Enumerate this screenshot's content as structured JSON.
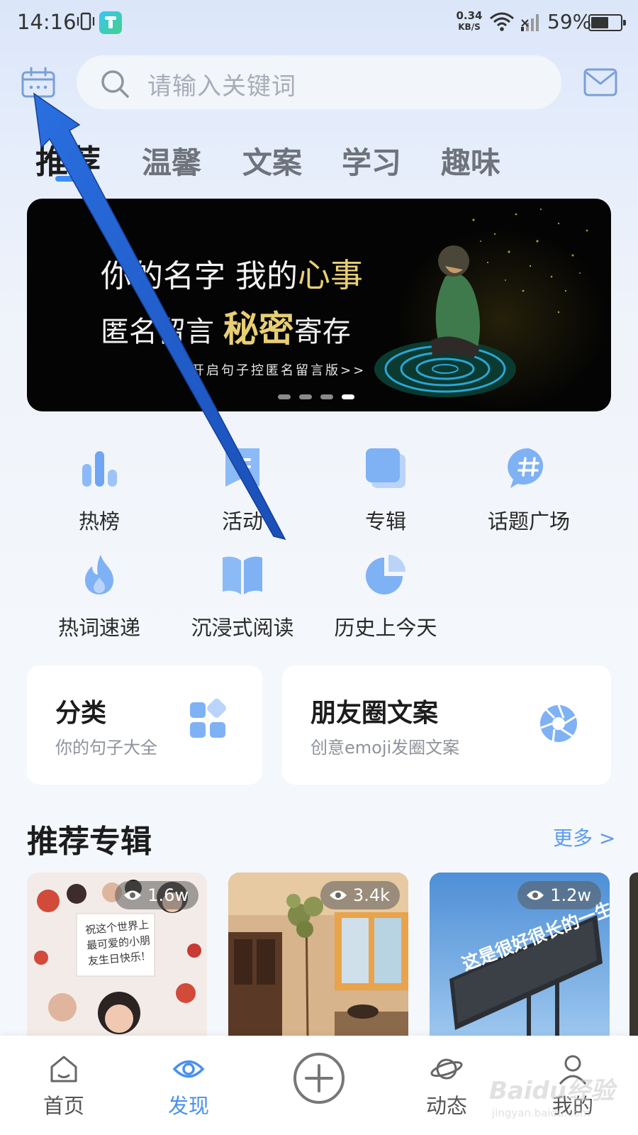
{
  "status_bar": {
    "time": "14:16",
    "net_speed_value": "0.34",
    "net_speed_unit": "KB/S",
    "battery": "59%",
    "battery_level": 0.59,
    "icons": [
      "vibrate-icon",
      "app-notification-icon",
      "wifi-icon",
      "cellular-signal-icon",
      "battery-icon"
    ]
  },
  "header": {
    "search_placeholder": "请输入关键词",
    "left_icon": "calendar-icon",
    "right_icon": "mail-icon"
  },
  "tabs": [
    {
      "label": "推荐",
      "active": true
    },
    {
      "label": "温馨",
      "active": false
    },
    {
      "label": "文案",
      "active": false
    },
    {
      "label": "学习",
      "active": false
    },
    {
      "label": "趣味",
      "active": false
    }
  ],
  "banner": {
    "line1_a": "你的名字 我的",
    "line1_b": "心事",
    "line2_a": "匿名留言 ",
    "line2_b": "秘密",
    "line2_c": "寄存",
    "cta": "开启句子控匿名留言版>>",
    "page_count": 4,
    "active_page": 4
  },
  "features": [
    {
      "label": "热榜",
      "icon": "bar-chart-icon"
    },
    {
      "label": "活动",
      "icon": "bookmark-list-icon"
    },
    {
      "label": "专辑",
      "icon": "album-stack-icon"
    },
    {
      "label": "话题广场",
      "icon": "hashtag-bubble-icon"
    },
    {
      "label": "热词速递",
      "icon": "flame-icon"
    },
    {
      "label": "沉浸式阅读",
      "icon": "open-book-icon"
    },
    {
      "label": "历史上今天",
      "icon": "pie-clock-icon"
    }
  ],
  "cards": [
    {
      "title": "分类",
      "subtitle": "你的句子大全",
      "icon": "category-grid-icon"
    },
    {
      "title": "朋友圈文案",
      "subtitle": "创意emoji发圈文案",
      "icon": "aperture-icon"
    }
  ],
  "recommended": {
    "title": "推荐专辑",
    "more": "更多 >",
    "albums": [
      {
        "views": "1.6w"
      },
      {
        "views": "3.4k"
      },
      {
        "views": "1.2w"
      }
    ],
    "image_texts": {
      "note": "祝这个世界上最可爱的小朋友生日快乐!",
      "billboard": "这是很好很长的一生"
    }
  },
  "bottom_nav": [
    {
      "label": "首页",
      "icon": "home-icon",
      "active": false
    },
    {
      "label": "发现",
      "icon": "eye-icon",
      "active": true
    },
    {
      "label": "",
      "icon": "add-circle-icon",
      "active": false
    },
    {
      "label": "动态",
      "icon": "planet-icon",
      "active": false
    },
    {
      "label": "我的",
      "icon": "profile-icon",
      "active": false
    }
  ],
  "watermark": {
    "brand": "Baidu经验",
    "url": "jingyan.baidu.com"
  },
  "colors": {
    "accent": "#4a90f0",
    "icon_blue": "#7fb1f5",
    "banner_highlight": "#e8cf74",
    "annotation_arrow": "#1f5fd0"
  }
}
